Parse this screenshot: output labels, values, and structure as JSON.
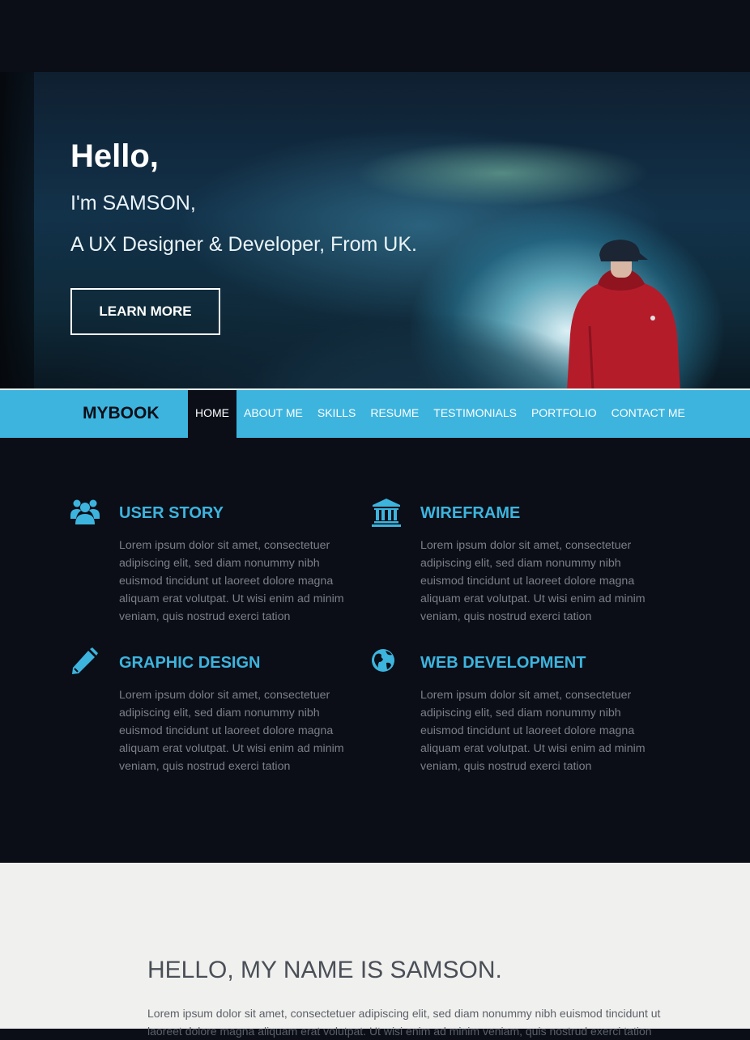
{
  "hero": {
    "greeting": "Hello,",
    "intro": "I'm SAMSON,",
    "tagline": "A UX Designer & Developer, From UK.",
    "cta_label": "LEARN MORE"
  },
  "navbar": {
    "brand": "MYBOOK",
    "items": [
      {
        "label": "HOME",
        "active": true
      },
      {
        "label": "ABOUT ME"
      },
      {
        "label": "SKILLS"
      },
      {
        "label": "RESUME"
      },
      {
        "label": "TESTIMONIALS"
      },
      {
        "label": "PORTFOLIO"
      },
      {
        "label": "CONTACT ME"
      }
    ]
  },
  "features": [
    {
      "icon": "users-icon",
      "title": "USER STORY",
      "text": "Lorem ipsum dolor sit amet, consectetuer adipiscing elit, sed diam nonummy nibh euismod tincidunt ut laoreet dolore magna aliquam erat volutpat. Ut wisi enim ad minim veniam, quis nostrud exerci tation"
    },
    {
      "icon": "bank-icon",
      "title": "WIREFRAME",
      "text": "Lorem ipsum dolor sit amet, consectetuer adipiscing elit, sed diam nonummy nibh euismod tincidunt ut laoreet dolore magna aliquam erat volutpat. Ut wisi enim ad minim veniam, quis nostrud exerci tation"
    },
    {
      "icon": "pencil-icon",
      "title": "GRAPHIC DESIGN",
      "text": "Lorem ipsum dolor sit amet, consectetuer adipiscing elit, sed diam nonummy nibh euismod tincidunt ut laoreet dolore magna aliquam erat volutpat. Ut wisi enim ad minim veniam, quis nostrud exerci tation"
    },
    {
      "icon": "globe-icon",
      "title": "WEB DEVELOPMENT",
      "text": "Lorem ipsum dolor sit amet, consectetuer adipiscing elit, sed diam nonummy nibh euismod tincidunt ut laoreet dolore magna aliquam erat volutpat. Ut wisi enim ad minim veniam, quis nostrud exerci tation"
    }
  ],
  "about": {
    "heading": "HELLO, MY NAME IS SAMSON.",
    "text": "Lorem ipsum dolor sit amet, consectetuer adipiscing elit, sed diam nonummy nibh euismod tincidunt ut laoreet dolore magna aliquam erat volutpat. Ut wisi enim ad minim veniam, quis nostrud exerci tation"
  },
  "colors": {
    "accent": "#3db4de",
    "dark_background": "#0b0e17",
    "light_background": "#f0f0ee"
  }
}
